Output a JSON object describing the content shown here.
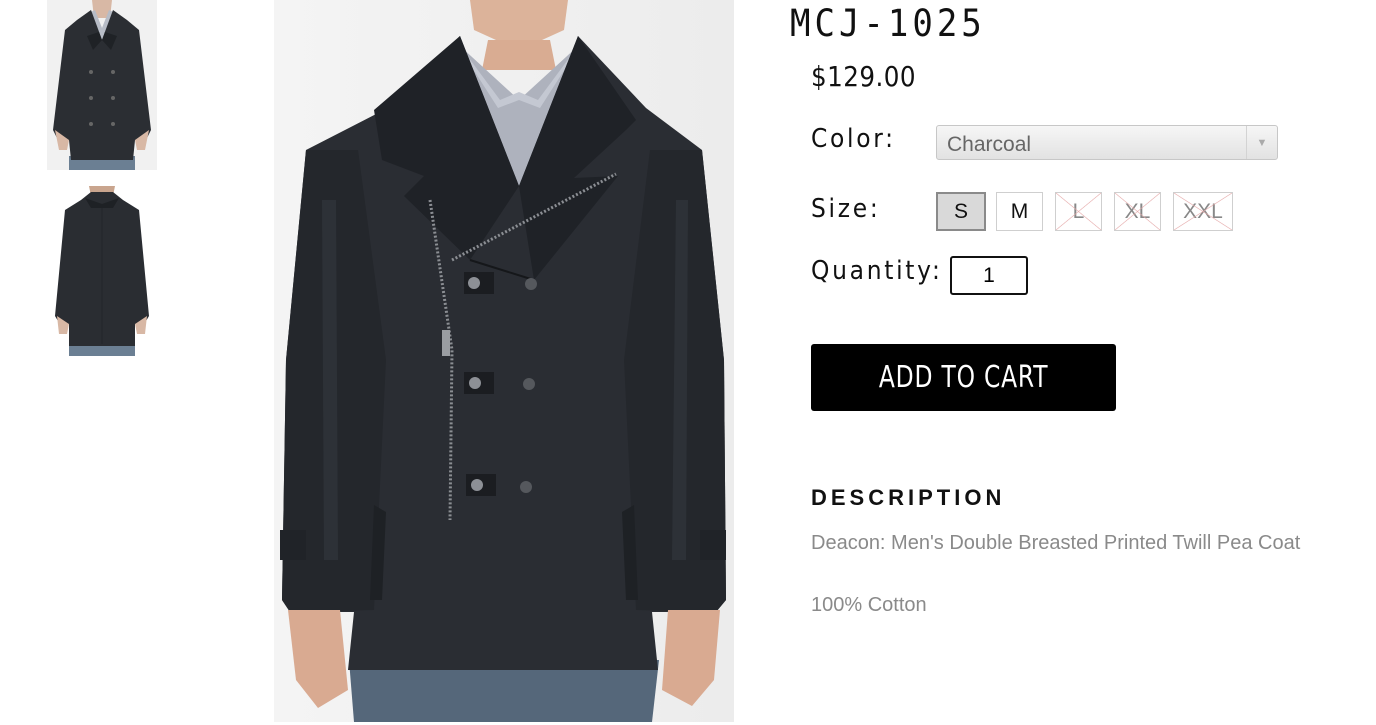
{
  "product": {
    "title": "MCJ-1025",
    "price": "$129.00",
    "images": {
      "thumbnails": [
        "coat-front-thumbnail",
        "coat-back-thumbnail"
      ],
      "main": "coat-front-photo"
    }
  },
  "options": {
    "color_label": "Color:",
    "color_value": "Charcoal",
    "size_label": "Size:",
    "sizes": [
      {
        "label": "S",
        "state": "selected"
      },
      {
        "label": "M",
        "state": "available"
      },
      {
        "label": "L",
        "state": "unavailable"
      },
      {
        "label": "XL",
        "state": "unavailable"
      },
      {
        "label": "XXL",
        "state": "unavailable"
      }
    ],
    "quantity_label": "Quantity:",
    "quantity_value": "1"
  },
  "actions": {
    "add_to_cart_label": "ADD TO CART"
  },
  "description": {
    "heading": "DESCRIPTION",
    "name": "Deacon: Men's Double Breasted Printed Twill Pea Coat",
    "material": "100% Cotton"
  },
  "colors": {
    "button_bg": "#000000",
    "muted_text": "#8a8a8a",
    "coat": "#2a2d32",
    "unavailable_strike": "#e5a8a8"
  }
}
